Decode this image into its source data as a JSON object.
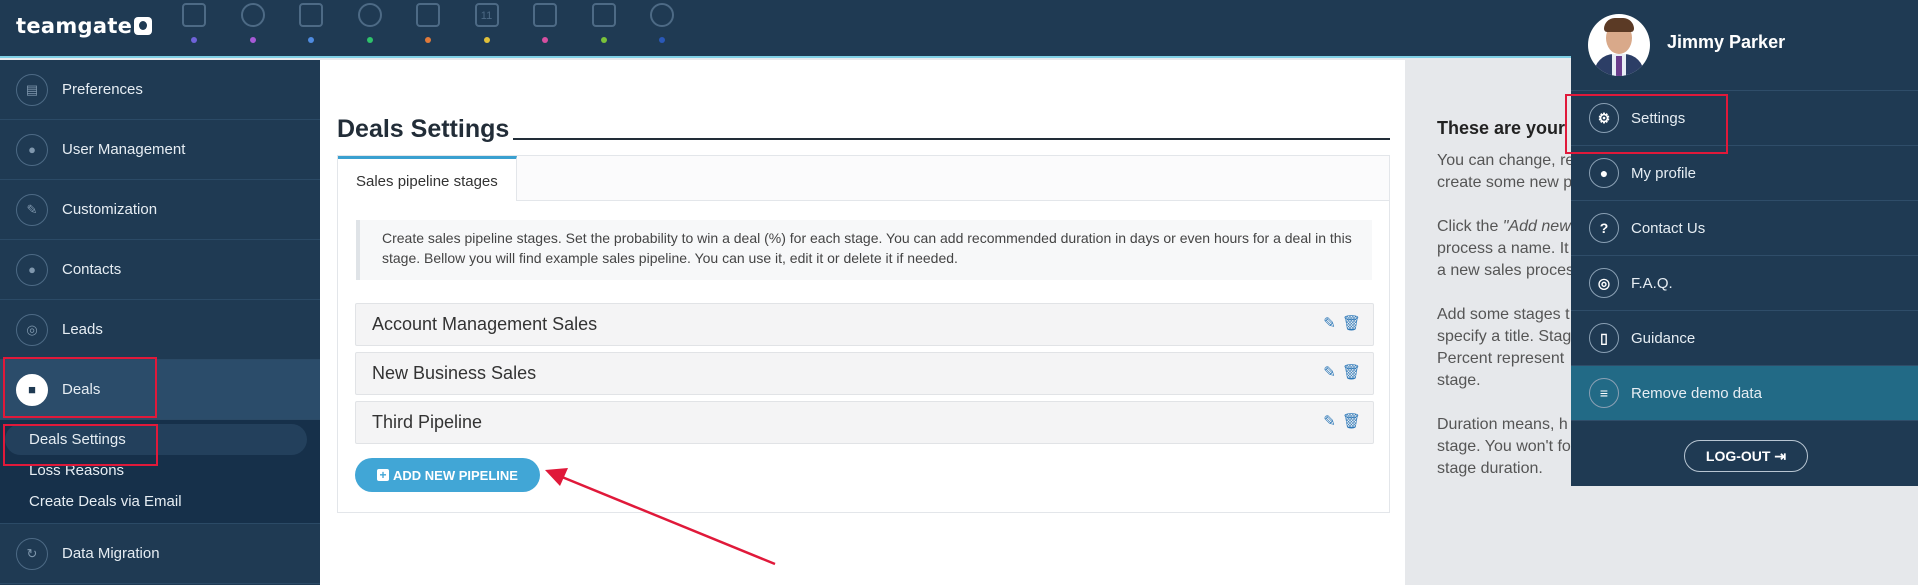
{
  "brand": {
    "name": "teamgate"
  },
  "nav_icons": [
    {
      "icon": "dashboard-icon",
      "color": "#6f63d9"
    },
    {
      "icon": "target-icon",
      "color": "#a65ad6"
    },
    {
      "icon": "building-icon",
      "color": "#4f8be0"
    },
    {
      "icon": "contacts-icon",
      "color": "#2ec26a"
    },
    {
      "icon": "briefcase-icon",
      "color": "#e07a3a"
    },
    {
      "icon": "calendar-icon",
      "color": "#e0c03a"
    },
    {
      "icon": "download-icon",
      "color": "#d64fa0"
    },
    {
      "icon": "document-icon",
      "color": "#7ac23a"
    },
    {
      "icon": "pie-chart-icon",
      "color": "#2a58b8"
    }
  ],
  "calendar_day": "11",
  "sidebar": {
    "items": [
      {
        "label": "Preferences",
        "icon": "preferences-icon"
      },
      {
        "label": "User Management",
        "icon": "users-icon"
      },
      {
        "label": "Customization",
        "icon": "wrench-icon"
      },
      {
        "label": "Contacts",
        "icon": "contact-icon"
      },
      {
        "label": "Leads",
        "icon": "leads-icon"
      },
      {
        "label": "Deals",
        "icon": "briefcase-icon"
      }
    ],
    "deals_sub": [
      {
        "label": "Deals Settings"
      },
      {
        "label": "Loss Reasons"
      },
      {
        "label": "Create Deals via Email"
      }
    ],
    "after": [
      {
        "label": "Data Migration",
        "icon": "sync-icon"
      }
    ]
  },
  "main": {
    "title": "Deals Settings",
    "tab_label": "Sales pipeline stages",
    "info_text": "Create sales pipeline stages. Set the probability to win a deal (%) for each stage. You can add recommended duration in days or even hours for a deal in this stage. Bellow you will find example sales pipeline. You can use it, edit it or delete it if needed.",
    "pipelines": [
      {
        "name": "Account Management Sales"
      },
      {
        "name": "New Business Sales"
      },
      {
        "name": "Third Pipeline"
      }
    ],
    "add_button": "ADD NEW PIPELINE"
  },
  "help": {
    "title": "These are your",
    "p1_l1": "You can change, re",
    "p1_l2": "create some new p",
    "p2_l1_a": "Click the ",
    "p2_l1_b": "\"Add new",
    "p2_l2": "process a name. It",
    "p2_l3": "a new sales proces",
    "p3_l1": "Add some stages t",
    "p3_l2": "specify a title. Stag",
    "p3_l3": "Percent represent",
    "p3_l4": "stage.",
    "p4_l1": "Duration means, h",
    "p4_l2": "stage. You won't fo",
    "p4_l3": "stage duration."
  },
  "user_menu": {
    "name": "Jimmy Parker",
    "items": [
      {
        "label": "Settings",
        "icon": "gear-icon"
      },
      {
        "label": "My profile",
        "icon": "profile-icon"
      },
      {
        "label": "Contact Us",
        "icon": "question-icon"
      },
      {
        "label": "F.A.Q.",
        "icon": "lifebuoy-icon"
      },
      {
        "label": "Guidance",
        "icon": "book-icon"
      },
      {
        "label": "Remove demo data",
        "icon": "database-icon"
      }
    ],
    "logout": "LOG-OUT"
  }
}
